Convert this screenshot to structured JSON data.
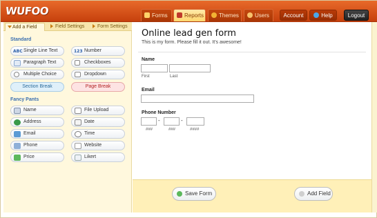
{
  "app": {
    "logo": "WUFOO"
  },
  "nav": {
    "tabs": [
      {
        "label": "Forms",
        "icon": "forms-icon"
      },
      {
        "label": "Reports",
        "icon": "reports-icon"
      },
      {
        "label": "Themes",
        "icon": "themes-icon"
      },
      {
        "label": "Users",
        "icon": "users-icon"
      }
    ],
    "account": "Account",
    "help": "Help",
    "logout": "Logout"
  },
  "subtabs": [
    "Add a Field",
    "Field Settings",
    "Form Settings"
  ],
  "standard": {
    "title": "Standard",
    "fields": [
      {
        "label": "Single Line Text",
        "icon": "ABC"
      },
      {
        "label": "Number",
        "icon": "123"
      },
      {
        "label": "Paragraph Text",
        "icon": "paragraph-icon"
      },
      {
        "label": "Checkboxes",
        "icon": "checkbox-icon"
      },
      {
        "label": "Multiple Choice",
        "icon": "radio-icon"
      },
      {
        "label": "Dropdown",
        "icon": "dropdown-icon"
      }
    ],
    "section_break": "Section Break",
    "page_break": "Page Break"
  },
  "fancy": {
    "title": "Fancy Pants",
    "fields": [
      {
        "label": "Name",
        "icon": "name-icon"
      },
      {
        "label": "File Upload",
        "icon": "upload-icon"
      },
      {
        "label": "Address",
        "icon": "globe-icon"
      },
      {
        "label": "Date",
        "icon": "calendar-icon"
      },
      {
        "label": "Email",
        "icon": "email-icon"
      },
      {
        "label": "Time",
        "icon": "clock-icon"
      },
      {
        "label": "Phone",
        "icon": "phone-icon"
      },
      {
        "label": "Website",
        "icon": "website-icon"
      },
      {
        "label": "Price",
        "icon": "price-icon"
      },
      {
        "label": "Likert",
        "icon": "likert-icon"
      }
    ]
  },
  "form": {
    "title": "Online lead gen form",
    "description": "This is my form. Please fill it out. It's awesome!",
    "name_label": "Name",
    "first": "First",
    "last": "Last",
    "email_label": "Email",
    "phone_label": "Phone Number",
    "phone_sub": [
      "###",
      "###",
      "####"
    ],
    "dash": "-"
  },
  "footer": {
    "save": "Save Form",
    "add": "Add Field"
  },
  "colors": {
    "accent": "#d4511a",
    "panel": "#fff8dd",
    "link": "#3b6fb0"
  }
}
